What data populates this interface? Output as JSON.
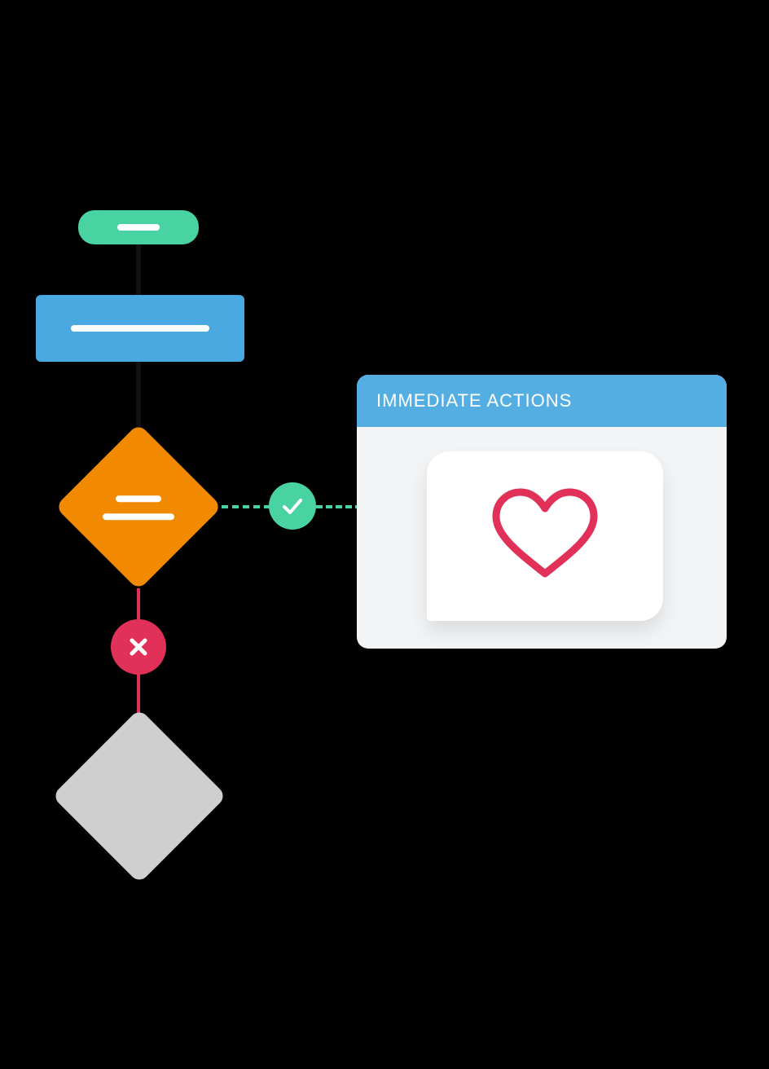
{
  "card": {
    "title": "IMMEDIATE ACTIONS"
  },
  "icons": {
    "check": "check-icon",
    "cross": "cross-icon",
    "heart": "heart-icon"
  },
  "colors": {
    "green": "#4ad3a2",
    "blue": "#4aa9e0",
    "headerBlue": "#54aee2",
    "orange": "#f18a00",
    "red": "#e23158",
    "gray": "#cfcfcf",
    "cardBg": "#f2f4f6"
  },
  "flow": {
    "nodes": [
      {
        "id": "start",
        "type": "terminator",
        "color": "green"
      },
      {
        "id": "process1",
        "type": "process",
        "color": "blue"
      },
      {
        "id": "decision1",
        "type": "decision",
        "color": "orange"
      },
      {
        "id": "decision2",
        "type": "decision",
        "color": "gray"
      }
    ],
    "edges": [
      {
        "from": "start",
        "to": "process1",
        "style": "solid",
        "color": "#111"
      },
      {
        "from": "process1",
        "to": "decision1",
        "style": "solid",
        "color": "#111"
      },
      {
        "from": "decision1",
        "to": "card",
        "style": "dashed",
        "color": "green",
        "icon": "check",
        "result": "yes"
      },
      {
        "from": "decision1",
        "to": "decision2",
        "style": "solid",
        "color": "red",
        "icon": "cross",
        "result": "no"
      }
    ]
  }
}
